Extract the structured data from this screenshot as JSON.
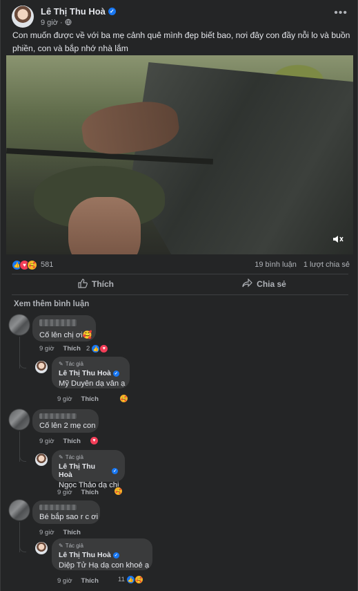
{
  "post": {
    "author": "Lê Thị Thu Hoà",
    "time": "9 giờ",
    "privacy_icon": "globe-icon",
    "caption": "Con muốn được về với ba mẹ cảnh quê mình đẹp biết bao, nơi đây con đầy nỗi lo và buồn phiền, con và bắp nhớ nhà lắm",
    "reaction_count": "581",
    "comment_count": "19 bình luận",
    "share_count": "1 lượt chia sẻ",
    "like_label": "Thích",
    "share_label": "Chia sẻ"
  },
  "comments": {
    "view_more": "Xem thêm bình luận",
    "items": [
      {
        "text": "Cố lên chị ơi🥰",
        "time": "9 giờ",
        "like": "Thích",
        "reaction_count": "2",
        "reply": {
          "tag": "Tác giả",
          "name": "Lê Thị Thu Hoà",
          "mention": "Mỹ Duyên",
          "text": " dạ vân ạ",
          "time": "9 giờ",
          "like": "Thích"
        }
      },
      {
        "text": "Cố lên 2 mẹ con",
        "time": "9 giờ",
        "like": "Thích",
        "reply": {
          "tag": "Tác giả",
          "name": "Lê Thị Thu Hoà",
          "mention": "Ngọc Thảo",
          "text": " dạ chị",
          "time": "9 giờ",
          "like": "Thích"
        }
      },
      {
        "text": "Bé bắp sao r c ơi",
        "time": "9 giờ",
        "like": "Thích",
        "reply": {
          "tag": "Tác giả",
          "name": "Lê Thị Thu Hoà",
          "mention": "Diệp Tử Hạ",
          "text": " dạ con khoẻ ạ",
          "time": "9 giờ",
          "like": "Thích",
          "reaction_count": "11"
        }
      }
    ]
  }
}
